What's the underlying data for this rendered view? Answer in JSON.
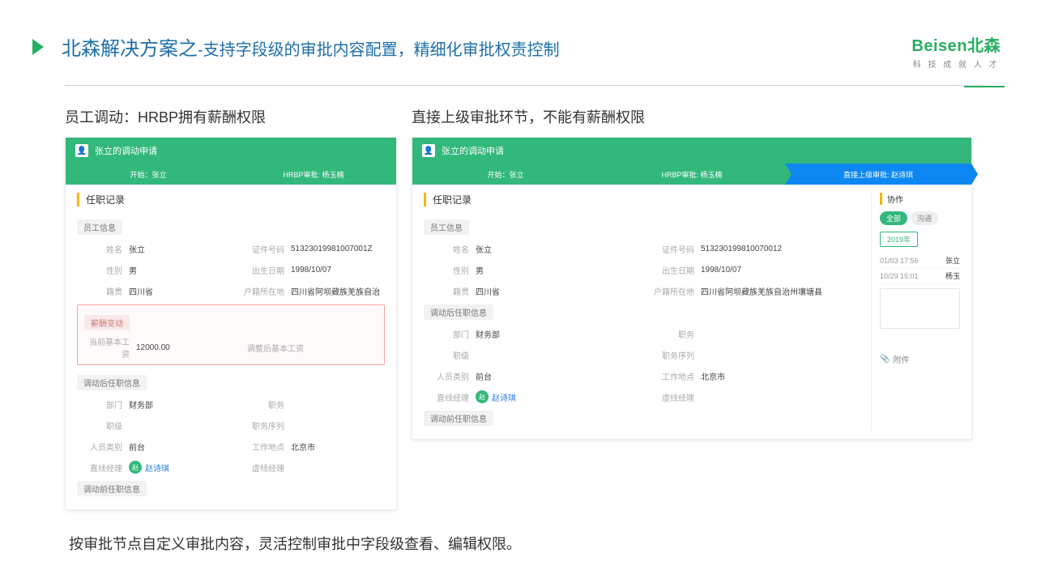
{
  "header": {
    "titleMain": "北森解决方案之",
    "titleSub": "-支持字段级的审批内容配置，精细化审批权责控制"
  },
  "logo": {
    "brand": "Beisen",
    "brandCn": "北森",
    "tagline": "科 技 成 就 人 才"
  },
  "left": {
    "subtitle": "员工调动：HRBP拥有薪酬权限",
    "cardTitle": "张立的调动申请",
    "wf1": "开始：张立",
    "wf2": "HRBP审批: 杨玉楠",
    "sec1": "任职记录",
    "grp1": "员工信息",
    "f_name_l": "姓名",
    "f_name_v": "张立",
    "f_id_l": "证件号码",
    "f_id_v": "51323019981007001Z",
    "f_sex_l": "性别",
    "f_sex_v": "男",
    "f_bd_l": "出生日期",
    "f_bd_v": "1998/10/07",
    "f_jg_l": "籍贯",
    "f_jg_v": "四川省",
    "f_hj_l": "户籍所在地",
    "f_hj_v": "四川省阿坝藏族羌族自治",
    "grp_salary": "薪酬变动",
    "f_cur_l": "当前基本工资",
    "f_cur_v": "12000.00",
    "f_adj_l": "调整后基本工资",
    "grp2": "调动后任职信息",
    "f_dept_l": "部门",
    "f_dept_v": "财务部",
    "f_pos_l": "职务",
    "f_lvl_l": "职级",
    "f_seq_l": "职务序列",
    "f_cat_l": "人员类别",
    "f_cat_v": "前台",
    "f_loc_l": "工作地点",
    "f_loc_v": "北京市",
    "f_mgr_l": "直线经理",
    "f_mgr_v": "赵诗琪",
    "f_mgr_a": "赵",
    "f_vmgr_l": "虚线经理",
    "grp3": "调动前任职信息"
  },
  "right": {
    "subtitle": "直接上级审批环节，不能有薪酬权限",
    "cardTitle": "张立的调动申请",
    "wf1": "开始：张立",
    "wf2": "HRBP审批: 杨玉楠",
    "wf3": "直接上级审批: 赵诗琪",
    "sec1": "任职记录",
    "grp1": "员工信息",
    "f_name_l": "姓名",
    "f_name_v": "张立",
    "f_id_l": "证件号码",
    "f_id_v": "513230199810070012",
    "f_sex_l": "性别",
    "f_sex_v": "男",
    "f_bd_l": "出生日期",
    "f_bd_v": "1998/10/07",
    "f_jg_l": "籍贯",
    "f_jg_v": "四川省",
    "f_hj_l": "户籍所在地",
    "f_hj_v": "四川省阿坝藏族羌族自治州壤塘县",
    "grp2": "调动后任职信息",
    "f_dept_l": "部门",
    "f_dept_v": "财务部",
    "f_pos_l": "职务",
    "f_lvl_l": "职级",
    "f_seq_l": "职务序列",
    "f_cat_l": "人员类别",
    "f_cat_v": "前台",
    "f_loc_l": "工作地点",
    "f_loc_v": "北京市",
    "f_mgr_l": "直线经理",
    "f_mgr_v": "赵诗琪",
    "f_mgr_a": "赵",
    "f_vmgr_l": "虚线经理",
    "grp3": "调动前任职信息",
    "side_title": "协作",
    "pill_all": "全部",
    "pill_chat": "沟通",
    "pill_year": "2019年",
    "t1a": "01/03 17:56",
    "t1b": "张立",
    "t2a": "10/29 15:01",
    "t2b": "杨玉",
    "attach": "附件"
  },
  "footer": "按审批节点自定义审批内容，灵活控制审批中字段级查看、编辑权限。"
}
